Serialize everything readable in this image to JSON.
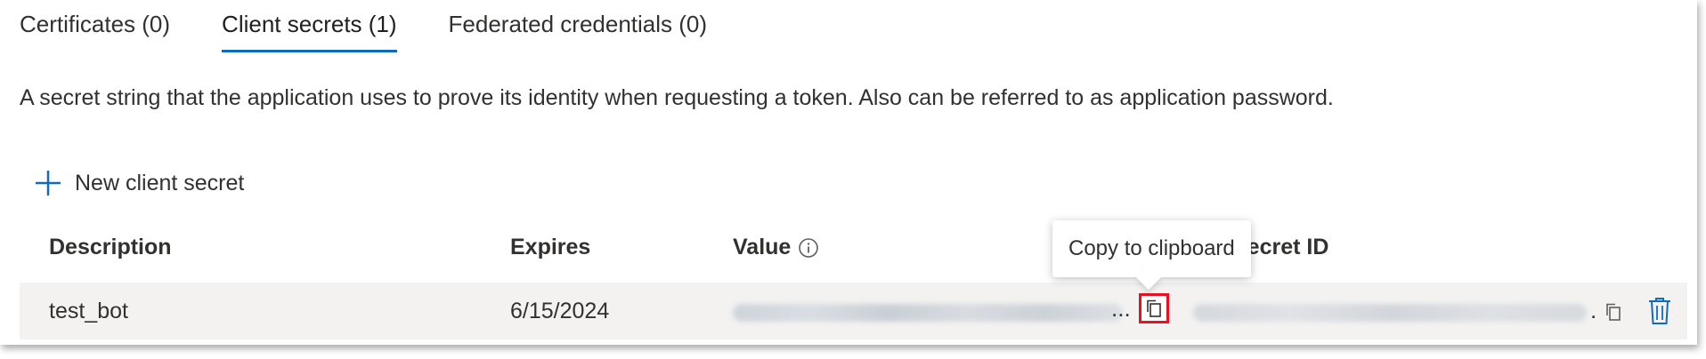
{
  "tabs": [
    {
      "label": "Certificates (0)",
      "active": false
    },
    {
      "label": "Client secrets (1)",
      "active": true
    },
    {
      "label": "Federated credentials (0)",
      "active": false
    }
  ],
  "description": "A secret string that the application uses to prove its identity when requesting a token. Also can be referred to as application password.",
  "new_secret": {
    "label": "New client secret",
    "icon": "plus-icon"
  },
  "table": {
    "headers": {
      "description": "Description",
      "expires": "Expires",
      "value": "Value",
      "secret_id": "Secret ID"
    },
    "rows": [
      {
        "description": "test_bot",
        "expires": "6/15/2024",
        "value_ellipsis": "...",
        "secret_id_ellipsis": "."
      }
    ]
  },
  "tooltip": {
    "text": "Copy to clipboard"
  },
  "icons": {
    "info": "info-icon",
    "copy": "copy-icon",
    "delete": "trash-icon"
  },
  "colors": {
    "accent": "#0f6cbd",
    "highlight": "#e81123",
    "row_bg": "#f3f2f1"
  }
}
